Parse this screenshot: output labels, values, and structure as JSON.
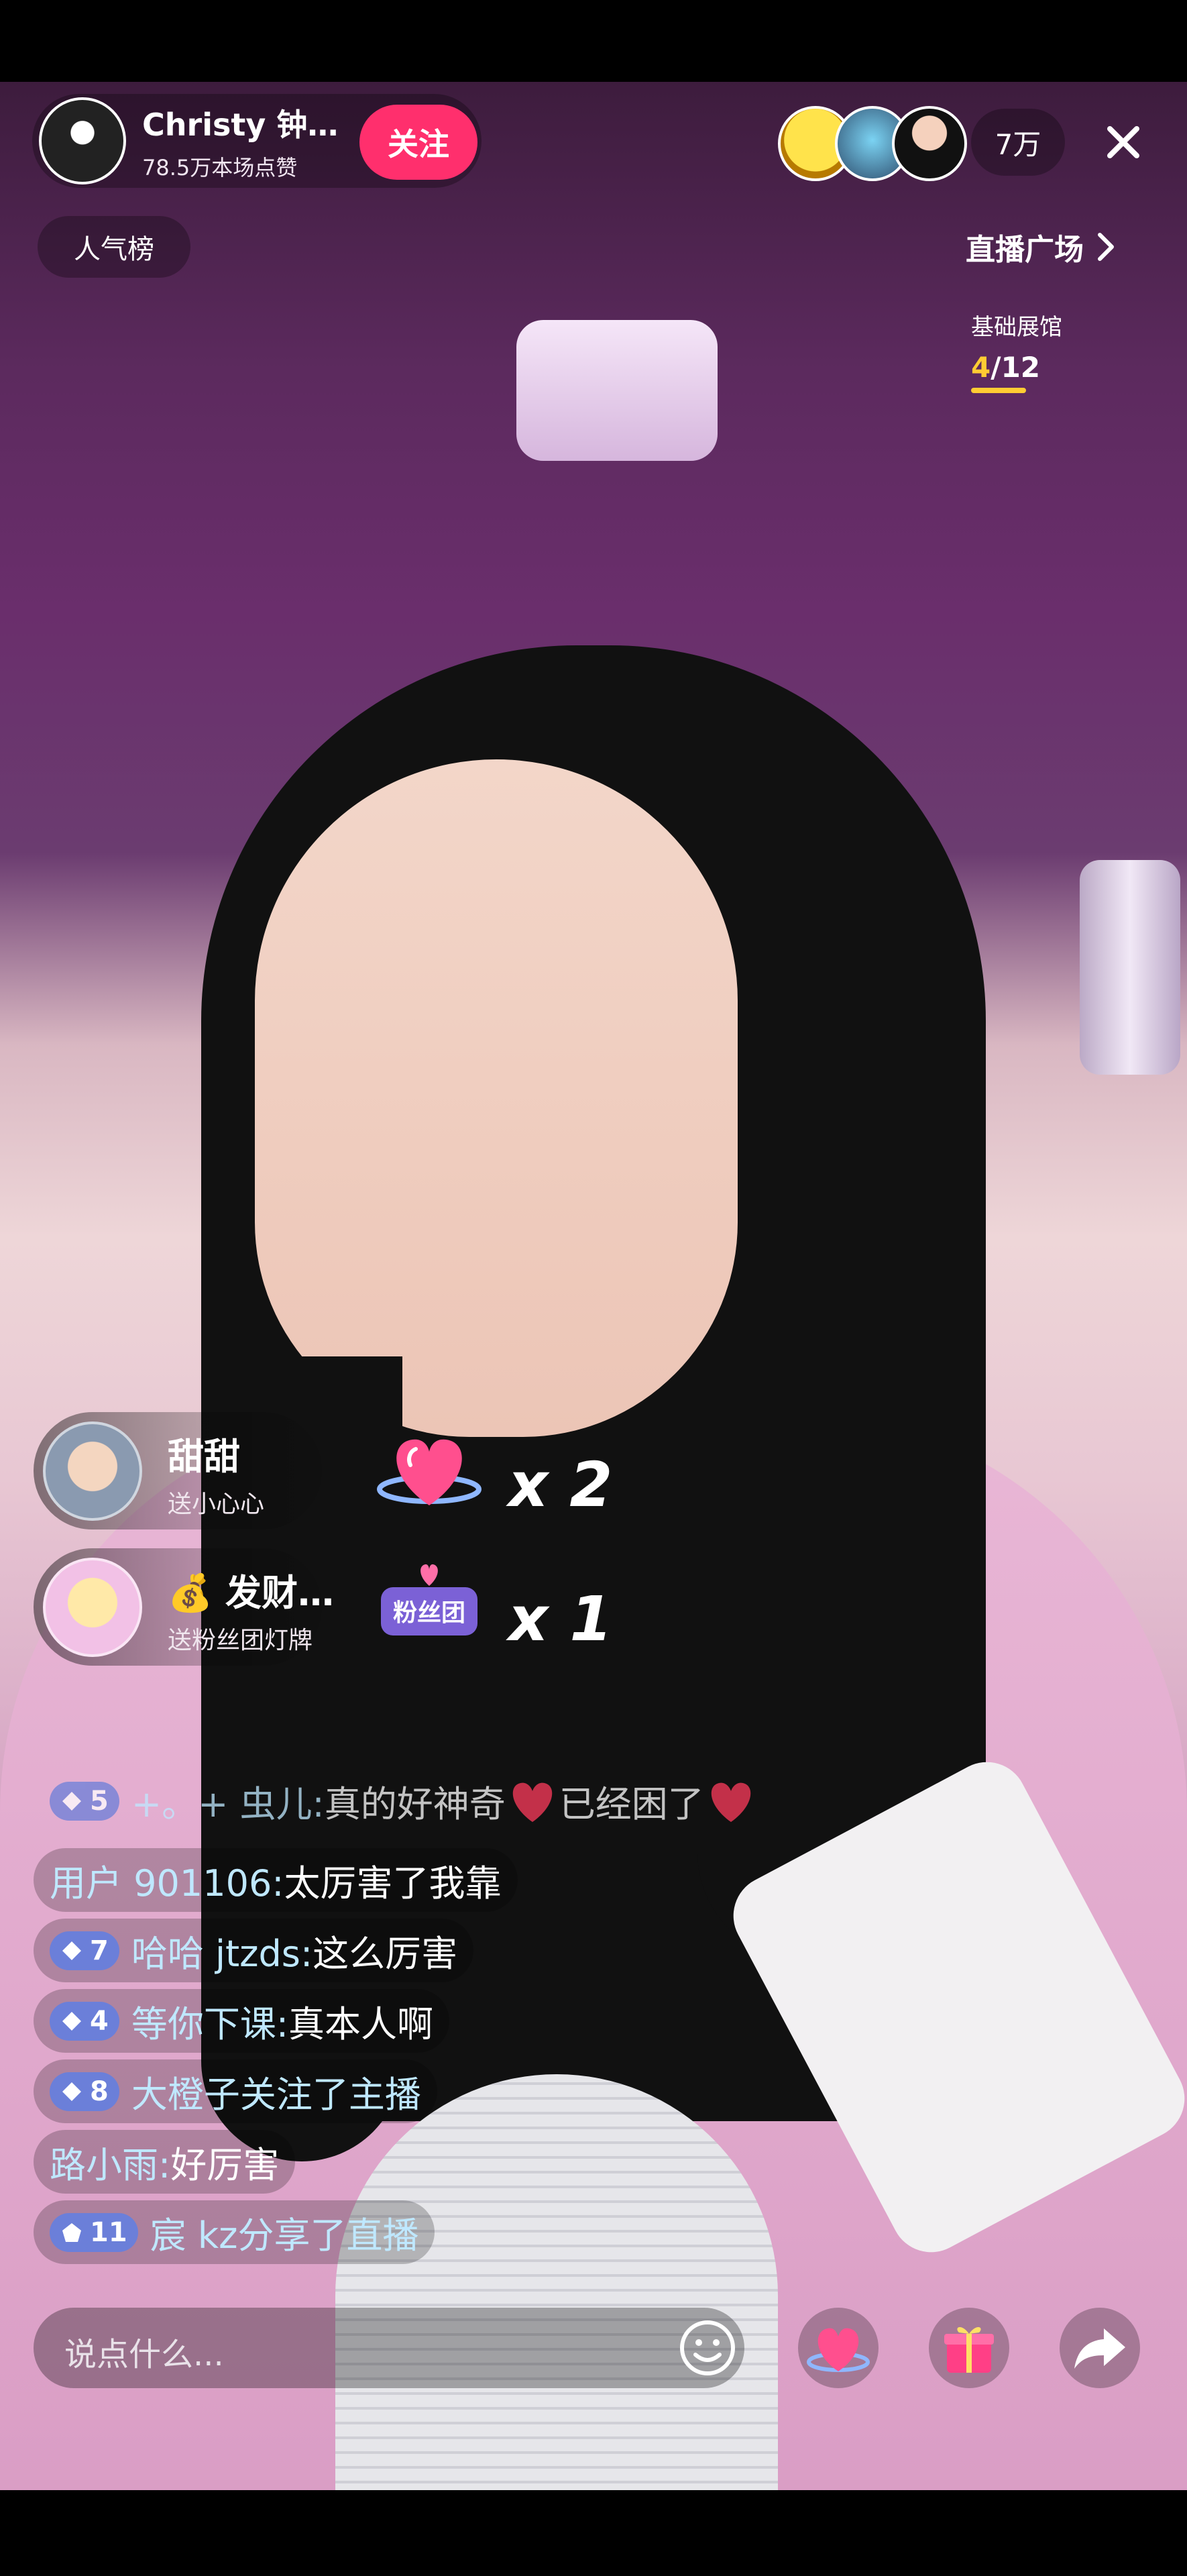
{
  "host": {
    "name": "Christy 钟…",
    "likes": "78.5万本场点赞",
    "follow_label": "关注"
  },
  "viewers": {
    "count": "7万",
    "avatars": [
      "viewer-avatar-1",
      "viewer-avatar-2",
      "viewer-avatar-3"
    ]
  },
  "top": {
    "rank_label": "人气榜",
    "plaza_label": "直播广场",
    "exhibit_title": "基础展馆",
    "exhibit_current": "4",
    "exhibit_total": "/12"
  },
  "gifts": [
    {
      "user": "甜甜",
      "desc": "送小心心",
      "count": "x 2",
      "icon": "heart-gift-icon"
    },
    {
      "user": "💰 发财…",
      "desc": "送粉丝团灯牌",
      "count": "x 1",
      "icon": "fan-club-badge-icon",
      "badge_text": "粉丝团"
    }
  ],
  "chat": [
    {
      "level": "5",
      "user": "+。+ 虫儿:",
      "message": " 真的好神奇",
      "message2": "已经困了"
    },
    {
      "user": "用户 901106:",
      "message": " 太厉害了我靠"
    },
    {
      "level": "7",
      "user": "哈哈 jtzds:",
      "message": " 这么厉害"
    },
    {
      "level": "4",
      "user": "等你下课:",
      "message": " 真本人啊"
    },
    {
      "level": "8",
      "user": "大橙子",
      "message": " 关注了主播"
    },
    {
      "user": "路小雨:",
      "message": " 好厉害"
    },
    {
      "level": "11",
      "user": "宸 kz",
      "message": " 分享了直播"
    }
  ],
  "input": {
    "placeholder": "说点什么..."
  },
  "colors": {
    "follow": "#ff2f6d",
    "level_badge": "#6b7fd9",
    "username": "#bfe8ff",
    "exhibit_accent": "#ffcc33"
  }
}
